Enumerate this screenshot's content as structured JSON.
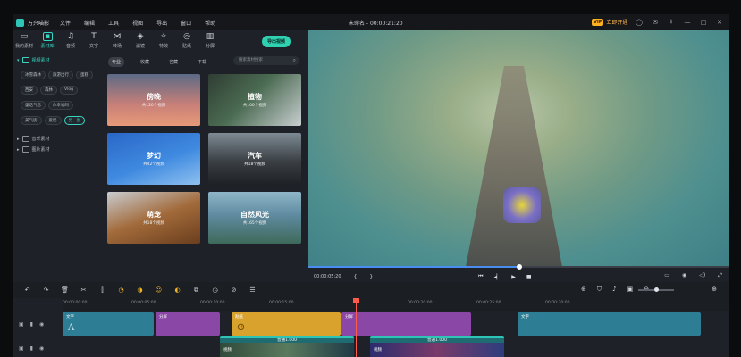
{
  "app": {
    "name": "万兴喵影",
    "menu": [
      "文件",
      "编辑",
      "工具",
      "视图",
      "导出",
      "窗口",
      "帮助"
    ],
    "doc_title": "未命名 - 00:00:21:20",
    "vip_badge": "VIP",
    "vip_text": "立即开通"
  },
  "toolbar": {
    "items": [
      {
        "icon": "folder-icon",
        "label": "我的素材"
      },
      {
        "icon": "media-library-icon",
        "label": "素材库",
        "active": true
      },
      {
        "icon": "music-note-icon",
        "label": "音频"
      },
      {
        "icon": "text-icon",
        "label": "文字"
      },
      {
        "icon": "transition-icon",
        "label": "转场"
      },
      {
        "icon": "filter-icon",
        "label": "滤镜"
      },
      {
        "icon": "sticker-icon",
        "label": "特效"
      },
      {
        "icon": "element-icon",
        "label": "贴纸"
      },
      {
        "icon": "split-screen-icon",
        "label": "分屏"
      }
    ],
    "export_label": "导出视频"
  },
  "tree": {
    "root": "视频素材",
    "chips": [
      "冰雪森林",
      "旅游出行",
      "蛋糕",
      "西安",
      "森林",
      "Vlog",
      "童话气息",
      "你幸福吗",
      "美气质",
      "爱秘",
      "另一张"
    ],
    "selected_chip": "另一张",
    "items": [
      "音乐素材",
      "图片素材"
    ]
  },
  "library": {
    "tabs": [
      "专业",
      "收藏",
      "名藏",
      "下载"
    ],
    "selected_tab": "专业",
    "search_placeholder": "搜索素材搜索",
    "cards": [
      {
        "title": "傍晚",
        "sub": "共120个视频"
      },
      {
        "title": "植物",
        "sub": "共100个视频"
      },
      {
        "title": "梦幻",
        "sub": "共42个视频"
      },
      {
        "title": "汽车",
        "sub": "共18个视频"
      },
      {
        "title": "萌宠",
        "sub": "共18个视频"
      },
      {
        "title": "自然风光",
        "sub": "共165个视频"
      }
    ]
  },
  "player": {
    "timecode": "00:00:05:20",
    "progress": 0.5,
    "brackets": [
      "{",
      "}"
    ]
  },
  "timeline": {
    "ticks": [
      {
        "label": "00:00:00:00",
        "pos": 0
      },
      {
        "label": "00:00:05:00",
        "pos": 1
      },
      {
        "label": "00:00:10:00",
        "pos": 2
      },
      {
        "label": "00:00:15:00",
        "pos": 3
      },
      {
        "label": "00:00:20:00",
        "pos": 4
      },
      {
        "label": "00:00:25:00",
        "pos": 5
      },
      {
        "label": "00:00:30:00",
        "pos": 6
      },
      {
        "label": "00:00:35:00",
        "pos": 7
      }
    ],
    "text_clips": [
      "文字",
      "分屏",
      "贴纸",
      "分屏",
      "文字"
    ],
    "video_clips": [
      {
        "label": "普通1.000",
        "name": "视频"
      },
      {
        "label": "普通1.000",
        "name": "视频"
      }
    ],
    "zoom": 0.5
  }
}
